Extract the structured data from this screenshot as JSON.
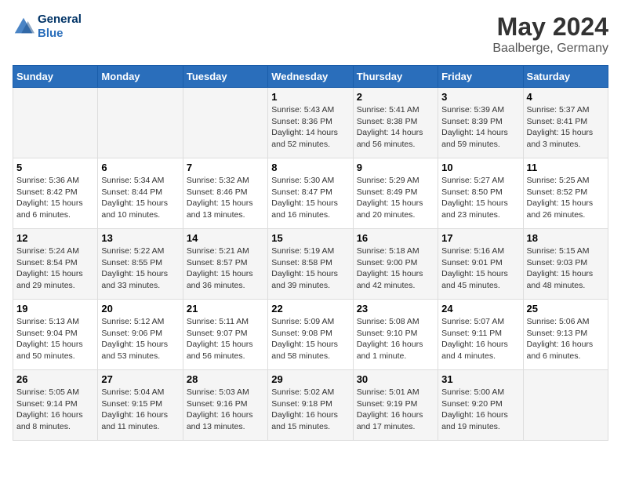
{
  "logo": {
    "line1": "General",
    "line2": "Blue"
  },
  "title": "May 2024",
  "subtitle": "Baalberge, Germany",
  "weekdays": [
    "Sunday",
    "Monday",
    "Tuesday",
    "Wednesday",
    "Thursday",
    "Friday",
    "Saturday"
  ],
  "weeks": [
    [
      {
        "day": "",
        "info": ""
      },
      {
        "day": "",
        "info": ""
      },
      {
        "day": "",
        "info": ""
      },
      {
        "day": "1",
        "info": "Sunrise: 5:43 AM\nSunset: 8:36 PM\nDaylight: 14 hours\nand 52 minutes."
      },
      {
        "day": "2",
        "info": "Sunrise: 5:41 AM\nSunset: 8:38 PM\nDaylight: 14 hours\nand 56 minutes."
      },
      {
        "day": "3",
        "info": "Sunrise: 5:39 AM\nSunset: 8:39 PM\nDaylight: 14 hours\nand 59 minutes."
      },
      {
        "day": "4",
        "info": "Sunrise: 5:37 AM\nSunset: 8:41 PM\nDaylight: 15 hours\nand 3 minutes."
      }
    ],
    [
      {
        "day": "5",
        "info": "Sunrise: 5:36 AM\nSunset: 8:42 PM\nDaylight: 15 hours\nand 6 minutes."
      },
      {
        "day": "6",
        "info": "Sunrise: 5:34 AM\nSunset: 8:44 PM\nDaylight: 15 hours\nand 10 minutes."
      },
      {
        "day": "7",
        "info": "Sunrise: 5:32 AM\nSunset: 8:46 PM\nDaylight: 15 hours\nand 13 minutes."
      },
      {
        "day": "8",
        "info": "Sunrise: 5:30 AM\nSunset: 8:47 PM\nDaylight: 15 hours\nand 16 minutes."
      },
      {
        "day": "9",
        "info": "Sunrise: 5:29 AM\nSunset: 8:49 PM\nDaylight: 15 hours\nand 20 minutes."
      },
      {
        "day": "10",
        "info": "Sunrise: 5:27 AM\nSunset: 8:50 PM\nDaylight: 15 hours\nand 23 minutes."
      },
      {
        "day": "11",
        "info": "Sunrise: 5:25 AM\nSunset: 8:52 PM\nDaylight: 15 hours\nand 26 minutes."
      }
    ],
    [
      {
        "day": "12",
        "info": "Sunrise: 5:24 AM\nSunset: 8:54 PM\nDaylight: 15 hours\nand 29 minutes."
      },
      {
        "day": "13",
        "info": "Sunrise: 5:22 AM\nSunset: 8:55 PM\nDaylight: 15 hours\nand 33 minutes."
      },
      {
        "day": "14",
        "info": "Sunrise: 5:21 AM\nSunset: 8:57 PM\nDaylight: 15 hours\nand 36 minutes."
      },
      {
        "day": "15",
        "info": "Sunrise: 5:19 AM\nSunset: 8:58 PM\nDaylight: 15 hours\nand 39 minutes."
      },
      {
        "day": "16",
        "info": "Sunrise: 5:18 AM\nSunset: 9:00 PM\nDaylight: 15 hours\nand 42 minutes."
      },
      {
        "day": "17",
        "info": "Sunrise: 5:16 AM\nSunset: 9:01 PM\nDaylight: 15 hours\nand 45 minutes."
      },
      {
        "day": "18",
        "info": "Sunrise: 5:15 AM\nSunset: 9:03 PM\nDaylight: 15 hours\nand 48 minutes."
      }
    ],
    [
      {
        "day": "19",
        "info": "Sunrise: 5:13 AM\nSunset: 9:04 PM\nDaylight: 15 hours\nand 50 minutes."
      },
      {
        "day": "20",
        "info": "Sunrise: 5:12 AM\nSunset: 9:06 PM\nDaylight: 15 hours\nand 53 minutes."
      },
      {
        "day": "21",
        "info": "Sunrise: 5:11 AM\nSunset: 9:07 PM\nDaylight: 15 hours\nand 56 minutes."
      },
      {
        "day": "22",
        "info": "Sunrise: 5:09 AM\nSunset: 9:08 PM\nDaylight: 15 hours\nand 58 minutes."
      },
      {
        "day": "23",
        "info": "Sunrise: 5:08 AM\nSunset: 9:10 PM\nDaylight: 16 hours\nand 1 minute."
      },
      {
        "day": "24",
        "info": "Sunrise: 5:07 AM\nSunset: 9:11 PM\nDaylight: 16 hours\nand 4 minutes."
      },
      {
        "day": "25",
        "info": "Sunrise: 5:06 AM\nSunset: 9:13 PM\nDaylight: 16 hours\nand 6 minutes."
      }
    ],
    [
      {
        "day": "26",
        "info": "Sunrise: 5:05 AM\nSunset: 9:14 PM\nDaylight: 16 hours\nand 8 minutes."
      },
      {
        "day": "27",
        "info": "Sunrise: 5:04 AM\nSunset: 9:15 PM\nDaylight: 16 hours\nand 11 minutes."
      },
      {
        "day": "28",
        "info": "Sunrise: 5:03 AM\nSunset: 9:16 PM\nDaylight: 16 hours\nand 13 minutes."
      },
      {
        "day": "29",
        "info": "Sunrise: 5:02 AM\nSunset: 9:18 PM\nDaylight: 16 hours\nand 15 minutes."
      },
      {
        "day": "30",
        "info": "Sunrise: 5:01 AM\nSunset: 9:19 PM\nDaylight: 16 hours\nand 17 minutes."
      },
      {
        "day": "31",
        "info": "Sunrise: 5:00 AM\nSunset: 9:20 PM\nDaylight: 16 hours\nand 19 minutes."
      },
      {
        "day": "",
        "info": ""
      }
    ]
  ]
}
